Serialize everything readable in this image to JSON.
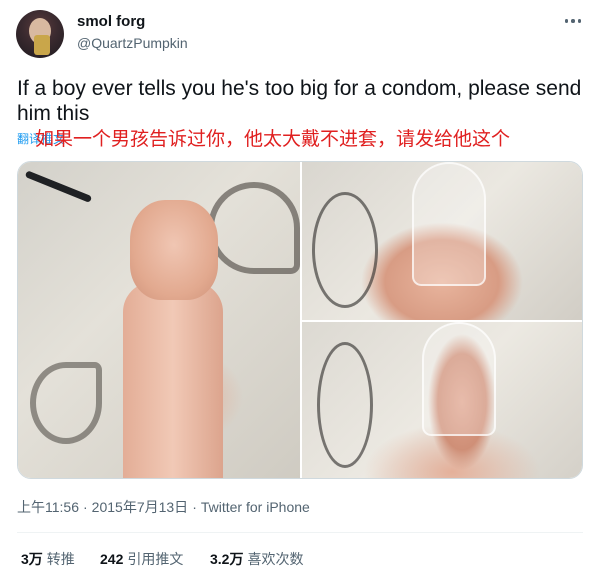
{
  "author": {
    "display_name": "smol forg",
    "handle": "@QuartzPumpkin"
  },
  "tweet": {
    "text": "If a boy ever tells you he's too big for a condom, please send him this",
    "translate_link": "翻译推文",
    "translation_overlay": "如果一个男孩告诉过你，他太大戴不进套，请发给他这个"
  },
  "meta": {
    "time": "上午11:56",
    "date": "2015年7月13日",
    "source": "Twitter for iPhone",
    "separator": "·"
  },
  "stats": {
    "retweets_count": "3万",
    "retweets_label": "转推",
    "quotes_count": "242",
    "quotes_label": "引用推文",
    "likes_count": "3.2万",
    "likes_label": "喜欢次数"
  },
  "icons": {
    "more": "more-options-icon"
  },
  "colors": {
    "text": "#0f1419",
    "secondary": "#536471",
    "link": "#1d9bf0",
    "translation": "#e02020"
  }
}
